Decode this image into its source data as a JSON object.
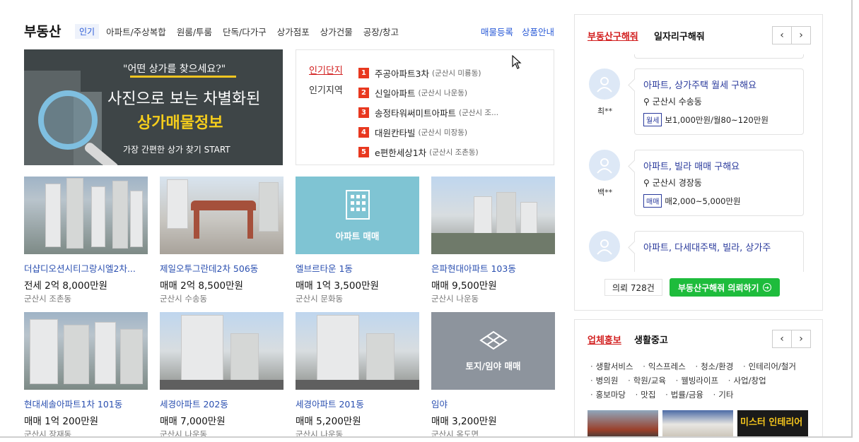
{
  "header": {
    "title": "부동산",
    "categories": [
      "인기",
      "아파트/주상복합",
      "원룸/투룸",
      "단독/다가구",
      "상가점포",
      "상가건물",
      "공장/창고"
    ],
    "links": [
      "매물등록",
      "상품안내"
    ]
  },
  "banner": {
    "quote": "\"어떤 상가를 찾으세요?\"",
    "line1": "사진으로 보는 차별화된",
    "line2": "상가매물정보",
    "line3": "가장 간편한 상가 찾기 START"
  },
  "popular": {
    "tab_complex": "인기단지",
    "tab_region": "인기지역",
    "items": [
      {
        "num": "1",
        "name": "주공아파트3차",
        "loc": "(군산시 미룡동)"
      },
      {
        "num": "2",
        "name": "신일아파트",
        "loc": "(군산시 나운동)"
      },
      {
        "num": "3",
        "name": "송정타워써미트아파트",
        "loc": "(군산시 조..."
      },
      {
        "num": "4",
        "name": "대원칸타빌",
        "loc": "(군산시 미장동)"
      },
      {
        "num": "5",
        "name": "e편한세상1차",
        "loc": "(군산시 조촌동)"
      }
    ]
  },
  "listings": [
    {
      "name": "더샵디오션시티그랑시엘2차...",
      "price": "전세 2억 8,000만원",
      "loc": "군산시 조촌동"
    },
    {
      "name": "제일오투그란데2차 506동",
      "price": "매매 2억 8,500만원",
      "loc": "군산시 수송동"
    },
    {
      "name": "엘브르타운 1동",
      "price": "매매 1억 3,500만원",
      "loc": "군산시 문화동",
      "placeholder": "아파트 매매"
    },
    {
      "name": "은파현대아파트 103동",
      "price": "매매 9,500만원",
      "loc": "군산시 나운동"
    },
    {
      "name": "현대세솔아파트1차 101동",
      "price": "매매 1억 200만원",
      "loc": "군산시 장재동"
    },
    {
      "name": "세경아파트 202동",
      "price": "매매 7,000만원",
      "loc": "군산시 나운동"
    },
    {
      "name": "세경아파트 201동",
      "price": "매매 5,200만원",
      "loc": "군산시 나운동"
    },
    {
      "name": "임야",
      "price": "매매 3,200만원",
      "loc": "군산시 옥도면",
      "placeholder": "토지/임야 매매"
    }
  ],
  "requests_panel": {
    "tab_active": "부동산구해줘",
    "tab_other": "일자리구해줘",
    "prev": "‹",
    "next": "›",
    "items": [
      {
        "user": "최**",
        "title": "아파트, 상가주택 월세 구해요",
        "area": "군산시 수송동",
        "tag": "월세",
        "price": "보1,000만원/월80~120만원"
      },
      {
        "user": "백**",
        "title": "아파트, 빌라 매매 구해요",
        "area": "군산시 경장동",
        "tag": "매매",
        "price": "매2,000~5,000만원"
      },
      {
        "user": "",
        "title": "아파트, 다세대주택, 빌라, 상가주",
        "area": "",
        "tag": "",
        "price": ""
      }
    ],
    "count": "의뢰 728건",
    "cta": "부동산구해줘 의뢰하기"
  },
  "business_panel": {
    "tab_active": "업체홍보",
    "tab_other": "생활중고",
    "prev": "‹",
    "next": "›",
    "categories": [
      "생활서비스",
      "익스프레스",
      "청소/환경",
      "인테리어/철거",
      "병의원",
      "학원/교육",
      "웰빙라이프",
      "사업/창업",
      "홍보마당",
      "맛집",
      "법률/금융",
      "기타"
    ],
    "thumb3_text": "미스터 인테리어"
  },
  "colors": {
    "accent_blue": "#2a5bd7",
    "accent_red": "#d21f1f",
    "cta_green": "#1ebc3c",
    "rank_red": "#e8381f"
  }
}
